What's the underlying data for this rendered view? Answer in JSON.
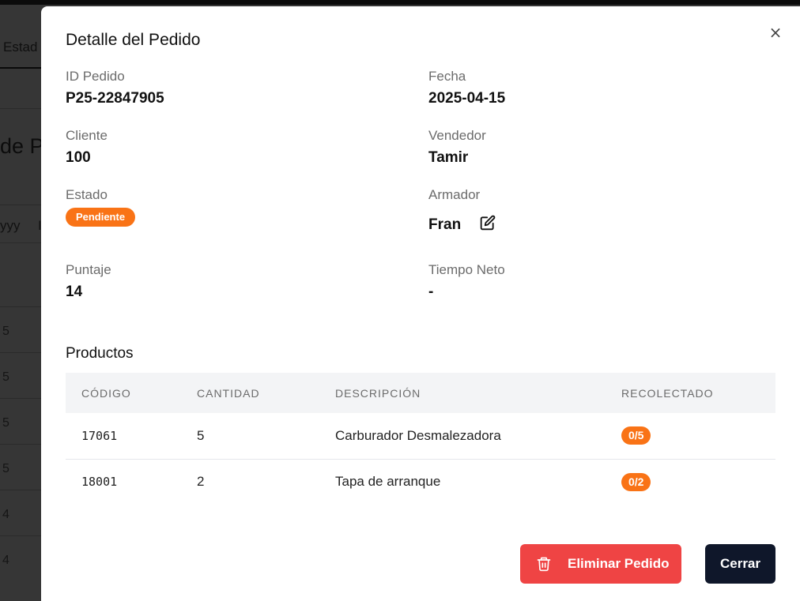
{
  "background": {
    "tab_label": "Estad",
    "heading": "de P",
    "filter_placeholder": "yyy",
    "filter_second": "I",
    "row_values": [
      "5",
      "5",
      "5",
      "5",
      "4",
      "4"
    ]
  },
  "modal": {
    "title": "Detalle del Pedido",
    "close_icon": "×",
    "fields": {
      "id_pedido": {
        "label": "ID Pedido",
        "value": "P25-22847905"
      },
      "fecha": {
        "label": "Fecha",
        "value": "2025-04-15"
      },
      "cliente": {
        "label": "Cliente",
        "value": "100"
      },
      "vendedor": {
        "label": "Vendedor",
        "value": "Tamir"
      },
      "estado": {
        "label": "Estado",
        "value": "Pendiente"
      },
      "armador": {
        "label": "Armador",
        "value": "Fran"
      },
      "puntaje": {
        "label": "Puntaje",
        "value": "14"
      },
      "tiempo_neto": {
        "label": "Tiempo Neto",
        "value": "-"
      }
    },
    "products": {
      "title": "Productos",
      "columns": [
        "CÓDIGO",
        "CANTIDAD",
        "DESCRIPCIÓN",
        "RECOLECTADO"
      ],
      "rows": [
        {
          "codigo": "17061",
          "cantidad": "5",
          "descripcion": "Carburador Desmalezadora",
          "recolectado": "0/5"
        },
        {
          "codigo": "18001",
          "cantidad": "2",
          "descripcion": "Tapa de arranque",
          "recolectado": "0/2"
        }
      ]
    },
    "actions": {
      "delete_label": "Eliminar Pedido",
      "close_label": "Cerrar"
    },
    "icons": {
      "close": "close-icon",
      "edit": "edit-icon",
      "delete": "trash-icon"
    },
    "colors": {
      "status_badge": "#f97316",
      "delete_button": "#ef4444",
      "close_button": "#0f172a"
    }
  }
}
